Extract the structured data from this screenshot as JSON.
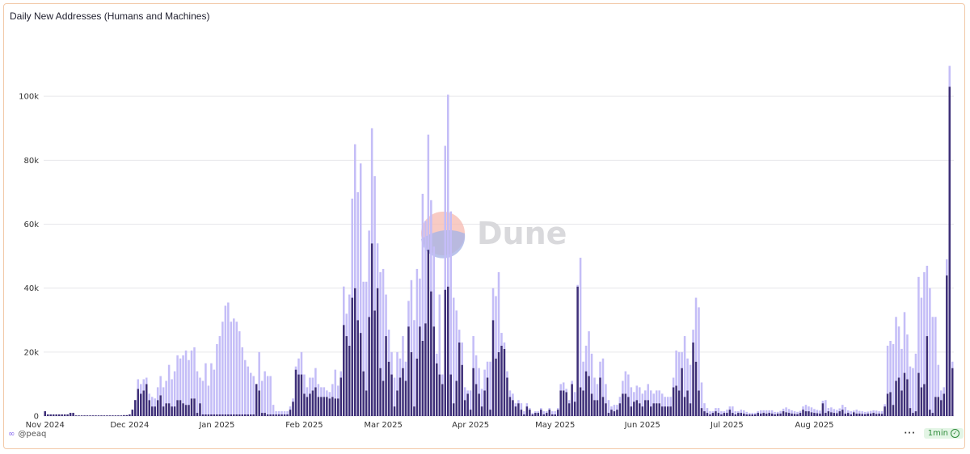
{
  "chart_data": {
    "type": "bar",
    "title": "Daily New Addresses (Humans and Machines)",
    "ylim": [
      0,
      120000
    ],
    "yticks": [
      {
        "value": 0,
        "label": "0"
      },
      {
        "value": 20000,
        "label": "20k"
      },
      {
        "value": 40000,
        "label": "40k"
      },
      {
        "value": 60000,
        "label": "60k"
      },
      {
        "value": 80000,
        "label": "80k"
      },
      {
        "value": 100000,
        "label": "100k"
      }
    ],
    "xticks": [
      {
        "date": "2024-11-01",
        "label": "Nov 2024"
      },
      {
        "date": "2024-12-01",
        "label": "Dec 2024"
      },
      {
        "date": "2025-01-01",
        "label": "Jan 2025"
      },
      {
        "date": "2025-02-01",
        "label": "Feb 2025"
      },
      {
        "date": "2025-03-01",
        "label": "Mar 2025"
      },
      {
        "date": "2025-04-01",
        "label": "Apr 2025"
      },
      {
        "date": "2025-05-01",
        "label": "May 2025"
      },
      {
        "date": "2025-06-01",
        "label": "Jun 2025"
      },
      {
        "date": "2025-07-01",
        "label": "Jul 2025"
      },
      {
        "date": "2025-08-01",
        "label": "Aug 2025"
      }
    ],
    "x_start": "2024-11-01",
    "stacked": true,
    "colors": {
      "dark": "#3d2e78",
      "light": "#c4bdf7"
    },
    "grid": true,
    "series": [
      {
        "values": [
          1500,
          500,
          500,
          500,
          500,
          500,
          500,
          500,
          500,
          1000,
          1000,
          200,
          200,
          200,
          200,
          200,
          200,
          200,
          200,
          200,
          200,
          200,
          200,
          200,
          200,
          200,
          200,
          200,
          300,
          300,
          500,
          2000,
          5000,
          8500,
          7000,
          8000,
          10000,
          5000,
          3000,
          3000,
          5000,
          6500,
          3000,
          4000,
          4000,
          3000,
          3000,
          5000,
          5000,
          4000,
          3500,
          3500,
          5500,
          5500,
          1000,
          4000,
          500,
          500,
          500,
          500,
          500,
          500,
          500,
          500,
          500,
          500,
          500,
          500,
          500,
          500,
          500,
          500,
          500,
          500,
          500,
          10000,
          8000,
          1000,
          1000,
          500,
          500,
          500,
          500,
          500,
          500,
          500,
          500,
          2000,
          4500,
          14500,
          13000,
          13000,
          7000,
          6000,
          7000,
          8000,
          9000,
          6000,
          6000,
          6000,
          6000,
          5500,
          6000,
          5500,
          5500,
          12000,
          28500,
          25000,
          22000,
          37000,
          40000,
          30000,
          26000,
          14000,
          8000,
          31000,
          54000,
          33000,
          40000,
          15000,
          11000,
          25000,
          17000,
          13000,
          3000,
          8000,
          12000,
          15000,
          11000,
          28000,
          20000,
          3000,
          18000,
          28000,
          23500,
          29000,
          52000,
          39000,
          28000,
          16500,
          13000,
          10000,
          39500,
          40500,
          13000,
          4000,
          11000,
          23000,
          16000,
          5000,
          7000,
          2000,
          15000,
          10000,
          7000,
          3000,
          8000,
          12000,
          2000,
          30000,
          18000,
          20000,
          22000,
          21000,
          12000,
          6000,
          5000,
          3000,
          4000,
          2000,
          500,
          3000,
          2000,
          500,
          1000,
          1000,
          2000,
          500,
          1000,
          2000,
          500,
          500,
          2000,
          8000,
          8000,
          7500,
          4000,
          10000,
          4500,
          40500,
          9000,
          8000,
          14000,
          12500,
          7000,
          5000,
          5000,
          12000,
          6000,
          4000,
          1000,
          2000,
          1500,
          2000,
          4000,
          7000,
          7000,
          6000,
          3000,
          4500,
          5000,
          4000,
          3000,
          5000,
          5000,
          3000,
          4000,
          4000,
          4000,
          3000,
          3000,
          3000,
          3000,
          9000,
          9500,
          8000,
          15000,
          6000,
          8000,
          4000,
          23000,
          17000,
          8000,
          2500,
          1500,
          1000,
          500,
          1000,
          1500,
          1000,
          500,
          1000,
          1000,
          2000,
          1000,
          500,
          1000,
          1000,
          800,
          500,
          500,
          500,
          500,
          1000,
          800,
          1000,
          800,
          1000,
          800,
          500,
          800,
          800,
          1500,
          1200,
          1000,
          800,
          700,
          600,
          1000,
          2000,
          1500,
          1500,
          1200,
          1000,
          900,
          800,
          4000,
          1000,
          1500,
          1200,
          1000,
          900,
          1500,
          2000,
          800,
          1000,
          500,
          1200,
          800,
          800,
          700,
          600,
          800,
          800,
          1000,
          700,
          800,
          700,
          3000,
          7000,
          7500,
          3500,
          11000,
          12000,
          8000,
          13500,
          11500,
          2500,
          1000,
          1500,
          13500,
          9000,
          10000,
          25000,
          2000,
          1000,
          6000,
          6000,
          5000,
          7000,
          44000,
          103000,
          15000
        ]
      },
      {
        "values": [
          0,
          0,
          0,
          0,
          0,
          0,
          0,
          0,
          0,
          0,
          0,
          0,
          0,
          0,
          0,
          0,
          0,
          0,
          0,
          0,
          0,
          0,
          0,
          0,
          0,
          0,
          0,
          0,
          0,
          0,
          0,
          0,
          0,
          3000,
          3000,
          3500,
          2000,
          2000,
          3000,
          2500,
          4000,
          6000,
          6000,
          7000,
          12000,
          8500,
          11000,
          14000,
          13000,
          15000,
          17000,
          14000,
          15000,
          16000,
          13000,
          8000,
          10500,
          16000,
          9000,
          16000,
          14000,
          22000,
          24500,
          29000,
          34000,
          35000,
          29000,
          30000,
          29000,
          26000,
          21000,
          17000,
          15000,
          13000,
          12000,
          0,
          12000,
          10000,
          13000,
          12000,
          12000,
          3000,
          1000,
          1000,
          1000,
          1000,
          1000,
          1000,
          1000,
          1000,
          5000,
          7000,
          6000,
          3000,
          5000,
          4000,
          6000,
          4000,
          3000,
          3000,
          2000,
          2000,
          4000,
          9000,
          4000,
          2000,
          12000,
          7000,
          16000,
          31000,
          45000,
          40000,
          53000,
          28000,
          34000,
          27000,
          36000,
          42000,
          14000,
          30000,
          35000,
          13000,
          10000,
          7000,
          9000,
          12000,
          6000,
          10000,
          6000,
          8000,
          22500,
          27000,
          28000,
          15000,
          46000,
          32000,
          36000,
          28500,
          25000,
          3000,
          25000,
          3000,
          45000,
          60000,
          51000,
          33000,
          22000,
          4000,
          7000,
          4000,
          1000,
          6000,
          10000,
          9000,
          8000,
          5500,
          6500,
          5000,
          15000,
          10000,
          19500,
          25000,
          4000,
          2000,
          2000,
          2000,
          2000,
          1000,
          1000,
          2000,
          1000,
          1000,
          500,
          500,
          500,
          500,
          500,
          1000,
          500,
          500,
          1000,
          1000,
          500,
          2000,
          2500,
          1000,
          1000,
          1000,
          3000,
          500,
          40500,
          9000,
          8000,
          14000,
          12500,
          7000,
          5000,
          5000,
          12000,
          6000,
          4000,
          1000,
          2000,
          1500,
          2000,
          4000,
          7000,
          7000,
          6000,
          3000,
          4500,
          5000,
          4000,
          3000,
          5000,
          5000,
          3000,
          4000,
          4000,
          4000,
          3000,
          3000,
          3000,
          3000,
          11000,
          12000,
          5000,
          19000,
          10000,
          12000,
          4000,
          20000,
          26000,
          8000,
          2500,
          1500,
          1000,
          500,
          1000,
          1500,
          1000,
          500,
          1000,
          1000,
          2000,
          1000,
          500,
          1000,
          1000,
          800,
          500,
          500,
          500,
          500,
          1000,
          800,
          1000,
          800,
          1000,
          800,
          500,
          800,
          800,
          1500,
          1200,
          1000,
          800,
          700,
          600,
          1000,
          2000,
          1500,
          1500,
          1200,
          1000,
          900,
          800,
          4000,
          1000,
          1500,
          1200,
          1000,
          900,
          1500,
          2000,
          800,
          1000,
          500,
          1200,
          800,
          800,
          700,
          600,
          800,
          800,
          1000,
          700,
          800,
          700,
          15000,
          16000,
          19000,
          20000,
          16000,
          13000,
          19000,
          14000,
          13000,
          14000,
          18000,
          30000,
          28000,
          35000,
          22000,
          38000,
          30000,
          25000,
          10000,
          3000,
          2000,
          5000,
          6500,
          2000,
          2000,
          1000
        ]
      }
    ]
  },
  "watermark": {
    "text": "Dune"
  },
  "footer": {
    "author": "@peaq",
    "refresh": "1min"
  }
}
